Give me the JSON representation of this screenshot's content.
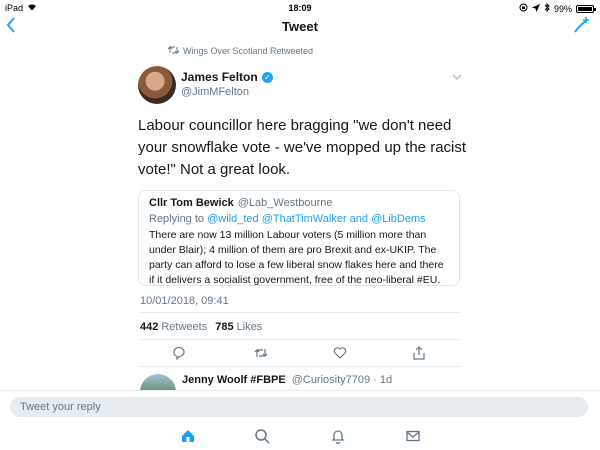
{
  "status": {
    "device": "iPad",
    "time": "18:09",
    "battery": "99%"
  },
  "nav": {
    "title": "Tweet",
    "back_icon": "chevron-left-icon",
    "compose_icon": "compose-icon"
  },
  "retweet": {
    "text": "Wings Over Scotland Retweeted"
  },
  "tweet": {
    "name": "James Felton",
    "handle": "@JimMFelton",
    "text": "Labour councillor here bragging \"we don't need your snowflake vote - we've mopped up the racist vote!\" Not a great look.",
    "timestamp": "10/01/2018, 09:41",
    "retweets": "442",
    "retweets_label": "Retweets",
    "likes": "785",
    "likes_label": "Likes"
  },
  "quote": {
    "name": "Cllr Tom Bewick",
    "handle": "@Lab_Westbourne",
    "replying_prefix": "Replying to",
    "replying_to": "@wild_ted @ThatTimWalker and @LibDems",
    "text": "There are now 13 million Labour voters (5 million more than under Blair); 4 million of them are pro Brexit and ex-UKIP. The party can afford to lose a few liberal snow flakes here and there if it delivers a socialist government, free of the neo-liberal #EU."
  },
  "next_tweet": {
    "name": "Jenny Woolf #FBPE",
    "meta": "@Curiosity7709 · 1d"
  },
  "reply": {
    "placeholder": "Tweet your reply"
  },
  "colors": {
    "accent": "#1da1f2",
    "muted": "#657786",
    "border": "#e1e8ed"
  }
}
